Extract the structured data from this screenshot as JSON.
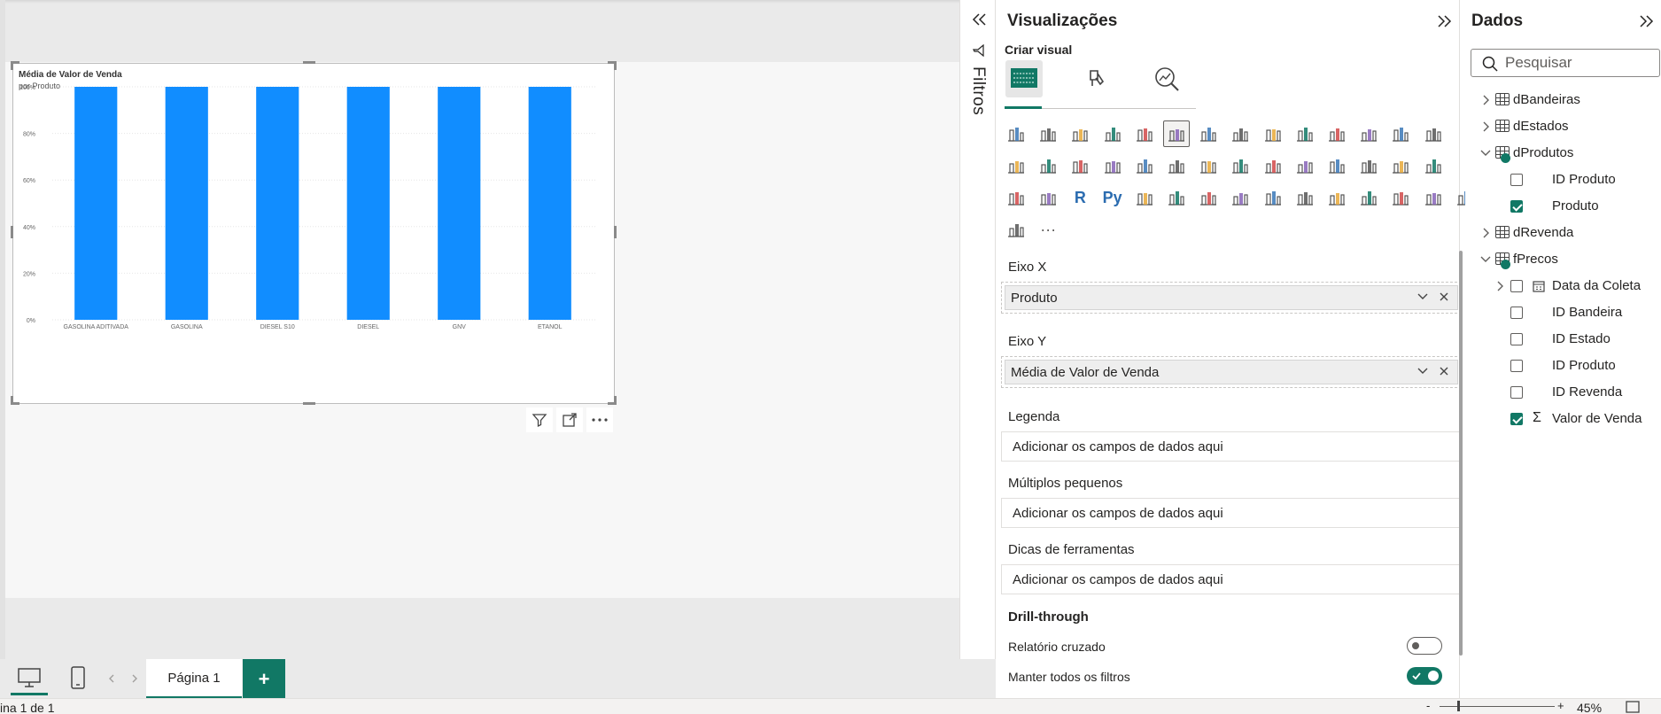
{
  "canvas": {
    "chart_title": "Média de Valor de Venda",
    "chart_subtitle": "por Produto"
  },
  "chart_data": {
    "type": "bar",
    "categories": [
      "GASOLINA ADITIVADA",
      "GASOLINA",
      "DIESEL S10",
      "DIESEL",
      "GNV",
      "ETANOL"
    ],
    "values": [
      100,
      100,
      100,
      100,
      100,
      100
    ],
    "title": "Média de Valor de Venda",
    "subtitle": "por Produto",
    "xlabel": "",
    "ylabel": "",
    "ylim": [
      0,
      100
    ],
    "y_ticks": [
      "0%",
      "20%",
      "40%",
      "60%",
      "80%",
      "100%"
    ],
    "y_tick_values": [
      0,
      20,
      40,
      60,
      80,
      100
    ],
    "grid": true,
    "color": "#118DFF"
  },
  "filters": {
    "label": "Filtros"
  },
  "visualizations": {
    "title": "Visualizações",
    "subtitle": "Criar visual",
    "icons": [
      "stacked-bar-icon",
      "stacked-column-icon",
      "clustered-bar-icon",
      "clustered-column-icon",
      "100-stacked-bar-icon",
      "100-stacked-column-icon",
      "line-chart-icon",
      "area-chart-icon",
      "stacked-area-icon",
      "100-stacked-area-icon",
      "line-clustered-column-icon",
      "line-stacked-column-icon",
      "ribbon-chart-icon",
      "waterfall-chart-icon",
      "funnel-chart-icon",
      "scatter-chart-icon",
      "pie-chart-icon",
      "donut-chart-icon",
      "treemap-icon",
      "map-icon",
      "filled-map-icon",
      "shape-map-icon",
      "azure-map-icon",
      "gauge-icon",
      "card-icon",
      "multi-row-card-icon",
      "kpi-icon",
      "slicer-icon",
      "table-icon",
      "matrix-icon",
      "r-visual-icon",
      "python-visual-icon",
      "key-influencers-icon",
      "decomposition-tree-icon",
      "qa-icon",
      "smart-narrative-icon",
      "metrics-icon",
      "paginated-report-icon",
      "power-apps-icon",
      "power-automate-icon",
      "image-icon",
      "arcgis-icon",
      "diamond-icon",
      "chevron-visual-icon",
      "more-visuals-icon"
    ],
    "r_label": "R",
    "py_label": "Py",
    "more_label": "···",
    "wells": {
      "x_label": "Eixo X",
      "x_field": "Produto",
      "y_label": "Eixo Y",
      "y_field": "Média de Valor de Venda",
      "legend_label": "Legenda",
      "legend_placeholder": "Adicionar os campos de dados aqui",
      "small_multiples_label": "Múltiplos pequenos",
      "small_multiples_placeholder": "Adicionar os campos de dados aqui",
      "tooltips_label": "Dicas de ferramentas",
      "tooltips_placeholder": "Adicionar os campos de dados aqui",
      "drillthrough_label": "Drill-through",
      "cross_report_label": "Relatório cruzado",
      "cross_report_on": false,
      "keep_filters_label": "Manter todos os filtros",
      "keep_filters_on": true
    }
  },
  "data_pane": {
    "title": "Dados",
    "search_placeholder": "Pesquisar",
    "tables": [
      {
        "name": "dBandeiras",
        "expanded": false,
        "has_check": false
      },
      {
        "name": "dEstados",
        "expanded": false,
        "has_check": false
      },
      {
        "name": "dProdutos",
        "expanded": true,
        "has_check": true,
        "fields": [
          {
            "name": "ID Produto",
            "checked": false
          },
          {
            "name": "Produto",
            "checked": true
          }
        ]
      },
      {
        "name": "dRevenda",
        "expanded": false,
        "has_check": false
      },
      {
        "name": "fPrecos",
        "expanded": true,
        "has_check": true,
        "fields": [
          {
            "name": "Data da Coleta",
            "checked": false,
            "expandable": true,
            "type": "date"
          },
          {
            "name": "ID Bandeira",
            "checked": false
          },
          {
            "name": "ID Estado",
            "checked": false
          },
          {
            "name": "ID Produto",
            "checked": false
          },
          {
            "name": "ID Revenda",
            "checked": false
          },
          {
            "name": "Valor de Venda",
            "checked": true,
            "type": "sum"
          }
        ]
      }
    ]
  },
  "bottom": {
    "page_tab": "Página 1",
    "add_label": "+",
    "status": "ina 1 de 1",
    "zoom": "45%",
    "zoom_minus": "-",
    "zoom_plus": "+"
  }
}
